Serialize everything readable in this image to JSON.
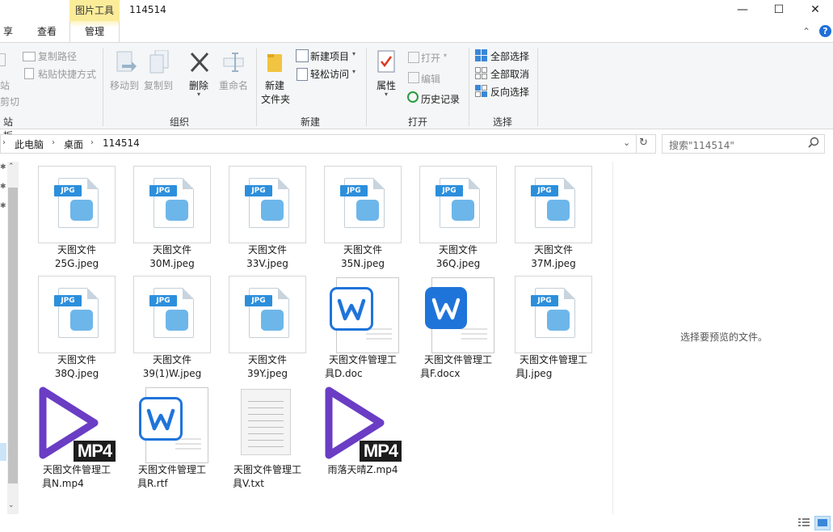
{
  "window": {
    "context_tab_header": "图片工具",
    "title": "114514",
    "minimize_glyph": "—",
    "maximize_glyph": "☐",
    "close_glyph": "✕"
  },
  "ribbon_tabs": [
    "享",
    "查看",
    "管理"
  ],
  "ribbon": {
    "clipboard_partial": {
      "paste": "站",
      "cut": "剪切",
      "label": "站板",
      "copy_path": "复制路径",
      "paste_shortcut": "粘贴快捷方式"
    },
    "organize": {
      "move_to": "移动到",
      "copy_to": "复制到",
      "delete": "删除",
      "rename": "重命名",
      "label": "组织"
    },
    "new": {
      "new_folder": "新建\n文件夹",
      "new_folder_l1": "新建",
      "new_folder_l2": "文件夹",
      "new_item": "新建项目",
      "easy_access": "轻松访问",
      "label": "新建"
    },
    "open": {
      "properties": "属性",
      "open": "打开",
      "edit": "编辑",
      "history": "历史记录",
      "label": "打开"
    },
    "select": {
      "select_all": "全部选择",
      "select_none": "全部取消",
      "invert": "反向选择",
      "label": "选择"
    }
  },
  "address": {
    "crumbs": [
      "此电脑",
      "桌面",
      "114514"
    ],
    "search_placeholder": "搜索\"114514\""
  },
  "files": [
    {
      "name": "天图文件25G.jpeg",
      "l1": "天图文件",
      "l2": "25G.jpeg",
      "type": "jpg"
    },
    {
      "name": "天图文件30M.jpeg",
      "l1": "天图文件",
      "l2": "30M.jpeg",
      "type": "jpg"
    },
    {
      "name": "天图文件33V.jpeg",
      "l1": "天图文件",
      "l2": "33V.jpeg",
      "type": "jpg"
    },
    {
      "name": "天图文件35N.jpeg",
      "l1": "天图文件",
      "l2": "35N.jpeg",
      "type": "jpg"
    },
    {
      "name": "天图文件36Q.jpeg",
      "l1": "天图文件",
      "l2": "36Q.jpeg",
      "type": "jpg"
    },
    {
      "name": "天图文件37M.jpeg",
      "l1": "天图文件",
      "l2": "37M.jpeg",
      "type": "jpg"
    },
    {
      "name": "天图文件38Q.jpeg",
      "l1": "天图文件",
      "l2": "38Q.jpeg",
      "type": "jpg"
    },
    {
      "name": "天图文件39(1)W.jpeg",
      "l1": "天图文件",
      "l2": "39(1)W.jpeg",
      "type": "jpg"
    },
    {
      "name": "天图文件39Y.jpeg",
      "l1": "天图文件",
      "l2": "39Y.jpeg",
      "type": "jpg"
    },
    {
      "name": "天图文件管理工具D.doc",
      "l1": "天图文件管理工",
      "l2": "具D.doc",
      "type": "doc"
    },
    {
      "name": "天图文件管理工具F.docx",
      "l1": "天图文件管理工",
      "l2": "具F.docx",
      "type": "docx"
    },
    {
      "name": "天图文件管理工具J.jpeg",
      "l1": "天图文件管理工",
      "l2": "具J.jpeg",
      "type": "jpg"
    },
    {
      "name": "天图文件管理工具N.mp4",
      "l1": "天图文件管理工",
      "l2": "具N.mp4",
      "type": "mp4"
    },
    {
      "name": "天图文件管理工具R.rtf",
      "l1": "天图文件管理工",
      "l2": "具R.rtf",
      "type": "rtf"
    },
    {
      "name": "天图文件管理工具V.txt",
      "l1": "天图文件管理工",
      "l2": "具V.txt",
      "type": "txt"
    },
    {
      "name": "雨落天晴Z.mp4",
      "l1": "雨落天晴Z.mp4",
      "l2": "",
      "type": "mp4"
    }
  ],
  "icon_labels": {
    "jpg": "JPG",
    "mp4": "MP4"
  },
  "preview_text": "选择要预览的文件。",
  "colors": {
    "context_tab": "#fbec9a",
    "accent_blue": "#1f74da",
    "mp4_purple": "#6a3dc4"
  }
}
